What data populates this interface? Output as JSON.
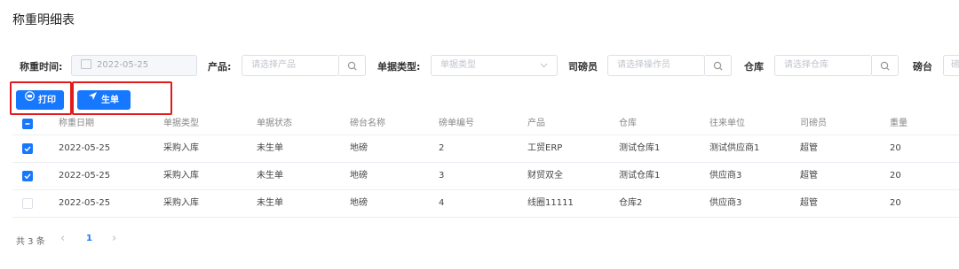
{
  "title": "称重明细表",
  "filters": {
    "time_label": "称重时间:",
    "time_value": "2022-05-25",
    "product_label": "产品:",
    "product_placeholder": "请选择产品",
    "doc_type_label": "单据类型:",
    "doc_type_placeholder": "单据类型",
    "weigher_label": "司磅员",
    "weigher_placeholder": "请选择操作员",
    "warehouse_label": "仓库",
    "warehouse_placeholder": "请选择仓库",
    "scale_label": "磅台",
    "scale_placeholder": "磅"
  },
  "toolbar": {
    "print_label": "打印",
    "generate_label": "生单"
  },
  "table": {
    "columns": [
      "称重日期",
      "单据类型",
      "单据状态",
      "磅台名称",
      "磅单编号",
      "产品",
      "仓库",
      "往来单位",
      "司磅员",
      "重量"
    ],
    "header_checked": true,
    "rows": [
      {
        "checked": true,
        "cells": [
          "2022-05-25",
          "采购入库",
          "未生单",
          "地磅",
          "2",
          "工贸ERP",
          "测试仓库1",
          "测试供应商1",
          "超管",
          "20"
        ]
      },
      {
        "checked": true,
        "cells": [
          "2022-05-25",
          "采购入库",
          "未生单",
          "地磅",
          "3",
          "财贸双全",
          "测试仓库1",
          "供应商3",
          "超管",
          "20"
        ]
      },
      {
        "checked": false,
        "cells": [
          "2022-05-25",
          "采购入库",
          "未生单",
          "地磅",
          "4",
          "线圈11111",
          "仓库2",
          "供应商3",
          "超管",
          "20"
        ]
      }
    ]
  },
  "pagination": {
    "total": "共 3 条",
    "prev": "‹",
    "current": "1",
    "next": "›"
  },
  "colors": {
    "primary": "#1677ff",
    "highlight": "#e11b1b"
  }
}
